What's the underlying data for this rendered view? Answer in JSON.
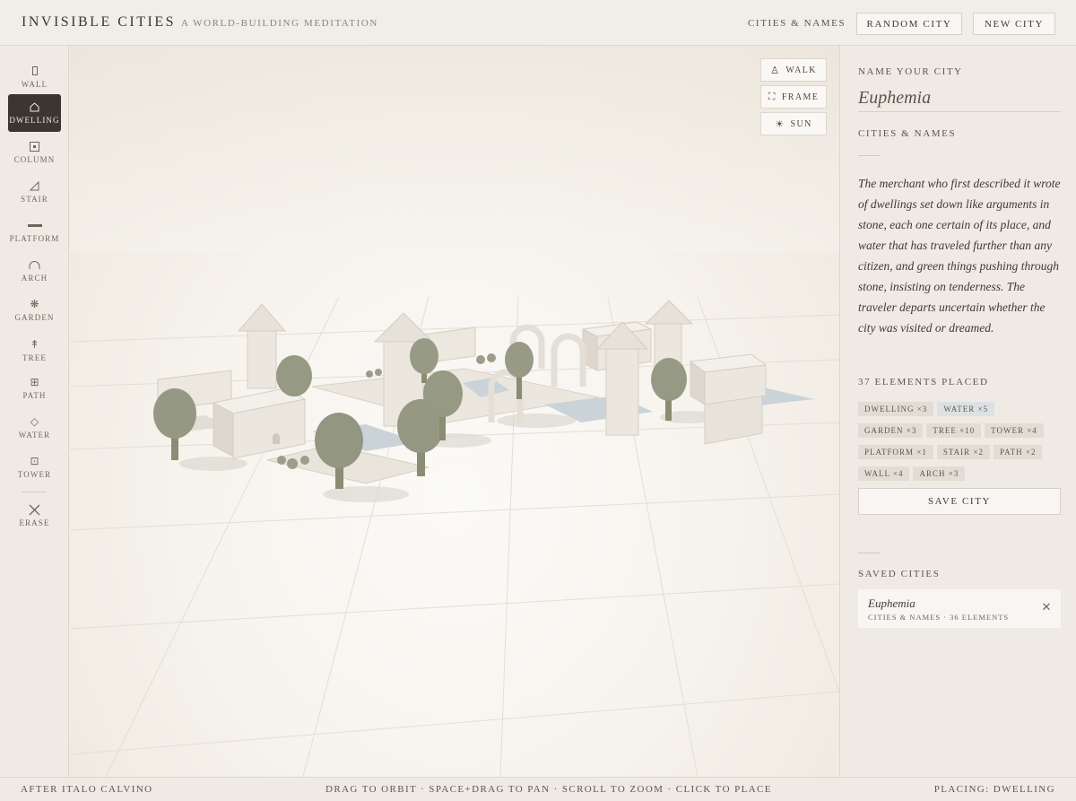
{
  "header": {
    "title": "INVISIBLE CITIES",
    "subtitle": "A WORLD-BUILDING MEDITATION",
    "nav_link": "CITIES & NAMES",
    "random_button": "RANDOM CITY",
    "new_button": "NEW CITY"
  },
  "toolbar": {
    "active": "DWELLING",
    "items": [
      {
        "label": "WALL",
        "icon": "wall-icon"
      },
      {
        "label": "DWELLING",
        "icon": "house-icon"
      },
      {
        "label": "COLUMN",
        "icon": "column-icon"
      },
      {
        "label": "STAIR",
        "icon": "stair-icon"
      },
      {
        "label": "PLATFORM",
        "icon": "platform-icon"
      },
      {
        "label": "ARCH",
        "icon": "arch-icon"
      },
      {
        "label": "GARDEN",
        "icon": "garden-icon"
      },
      {
        "label": "TREE",
        "icon": "tree-icon"
      },
      {
        "label": "PATH",
        "icon": "path-icon"
      },
      {
        "label": "WATER",
        "icon": "water-icon"
      },
      {
        "label": "TOWER",
        "icon": "tower-icon"
      },
      {
        "label": "ERASE",
        "icon": "close-icon"
      }
    ]
  },
  "viewport": {
    "buttons": [
      {
        "label": "WALK",
        "icon": "walk-icon"
      },
      {
        "label": "FRAME",
        "icon": "frame-icon"
      },
      {
        "label": "SUN",
        "icon": "sun-icon"
      }
    ]
  },
  "panel": {
    "name_label": "NAME YOUR CITY",
    "city_name": "Euphemia",
    "category_label": "CITIES & NAMES",
    "description": "The merchant who first described it wrote of dwellings set down like arguments in stone, each one certain of its place, and water that has traveled further than any citizen, and green things pushing through stone, insisting on tenderness. The traveler departs uncertain whether the city was visited or dreamed.",
    "elements_label": "37 ELEMENTS PLACED",
    "tags": [
      {
        "label": "DWELLING ×3",
        "kind": "default"
      },
      {
        "label": "WATER ×5",
        "kind": "water"
      },
      {
        "label": "GARDEN ×3",
        "kind": "default"
      },
      {
        "label": "TREE ×10",
        "kind": "default"
      },
      {
        "label": "TOWER ×4",
        "kind": "default"
      },
      {
        "label": "PLATFORM ×1",
        "kind": "default"
      },
      {
        "label": "STAIR ×2",
        "kind": "default"
      },
      {
        "label": "PATH ×2",
        "kind": "default"
      },
      {
        "label": "WALL ×4",
        "kind": "default"
      },
      {
        "label": "ARCH ×3",
        "kind": "default"
      }
    ],
    "save_button": "SAVE CITY",
    "saved_label": "SAVED CITIES",
    "saved_cities": [
      {
        "name": "Euphemia",
        "meta": "CITIES & NAMES · 36 ELEMENTS"
      }
    ]
  },
  "footer": {
    "left": "AFTER ITALO CALVINO",
    "center": "DRAG TO ORBIT · SPACE+DRAG TO PAN · SCROLL TO ZOOM · CLICK TO PLACE",
    "right": "PLACING: DWELLING"
  },
  "colors": {
    "background": "#efebe4",
    "ink": "#3e3a34",
    "active_tool": "#3b3630",
    "stone": "#e6e1d9",
    "foliage": "#8f927b",
    "water": "#c9d3d8"
  }
}
